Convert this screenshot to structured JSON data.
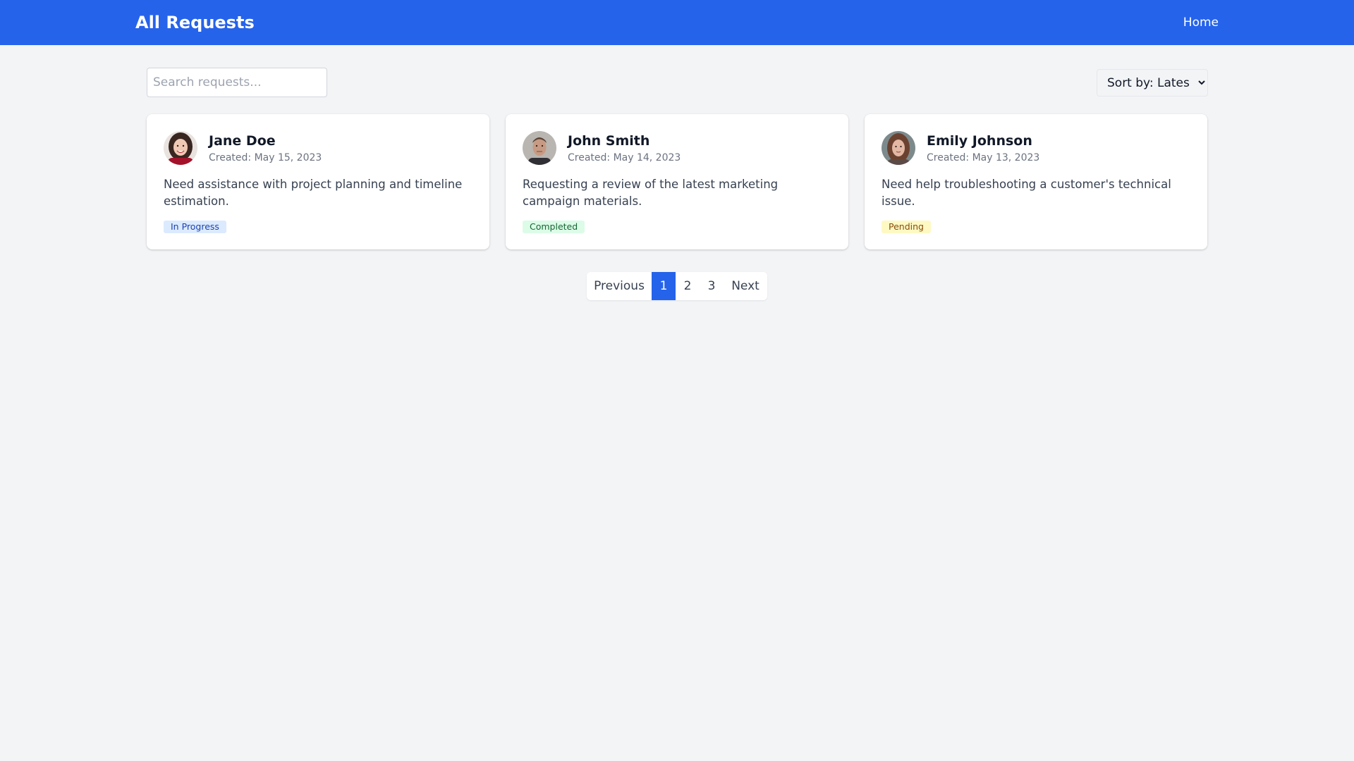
{
  "header": {
    "title": "All Requests",
    "home_label": "Home"
  },
  "toolbar": {
    "search_placeholder": "Search requests...",
    "search_value": "",
    "sort_label": "Sort by: Latest"
  },
  "requests": [
    {
      "name": "Jane Doe",
      "created": "Created: May 15, 2023",
      "description": "Need assistance with project planning and timeline estimation.",
      "status": "In Progress"
    },
    {
      "name": "John Smith",
      "created": "Created: May 14, 2023",
      "description": "Requesting a review of the latest marketing campaign materials.",
      "status": "Completed"
    },
    {
      "name": "Emily Johnson",
      "created": "Created: May 13, 2023",
      "description": "Need help troubleshooting a customer's technical issue.",
      "status": "Pending"
    }
  ],
  "pagination": {
    "previous_label": "Previous",
    "pages": [
      "1",
      "2",
      "3"
    ],
    "current_page": "1",
    "next_label": "Next"
  },
  "colors": {
    "primary": "#2563eb",
    "in_progress_bg": "#dbeafe",
    "in_progress_text": "#1e40af",
    "completed_bg": "#dcfce7",
    "completed_text": "#166534",
    "pending_bg": "#fef9c3",
    "pending_text": "#854d0e"
  }
}
